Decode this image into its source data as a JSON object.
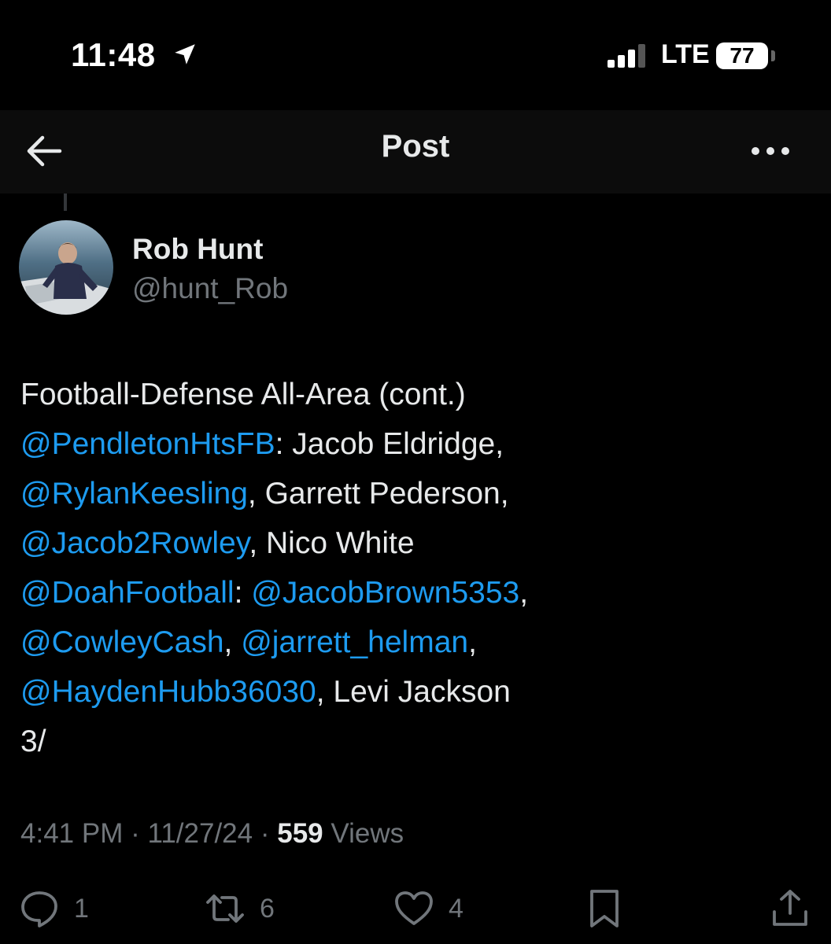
{
  "status_bar": {
    "time": "11:48",
    "network": "LTE",
    "battery": "77",
    "battery_level": 0.77,
    "icons": [
      "location-arrow-icon",
      "signal-bars-icon",
      "battery-icon"
    ]
  },
  "nav": {
    "title": "Post",
    "icons": [
      "back-arrow-icon",
      "more-dots-icon"
    ]
  },
  "post": {
    "author_name": "Rob Hunt",
    "author_handle": "@hunt_Rob",
    "lines": [
      [
        {
          "t": "Football-Defense All-Area (cont.)",
          "m": false
        }
      ],
      [
        {
          "t": "@PendletonHtsFB",
          "m": true
        },
        {
          "t": ": Jacob Eldridge,",
          "m": false
        }
      ],
      [
        {
          "t": "@RylanKeesling",
          "m": true
        },
        {
          "t": ", Garrett Pederson,",
          "m": false
        }
      ],
      [
        {
          "t": "@Jacob2Rowley",
          "m": true
        },
        {
          "t": ", Nico White",
          "m": false
        }
      ],
      [
        {
          "t": "@DoahFootball",
          "m": true
        },
        {
          "t": ": ",
          "m": false
        },
        {
          "t": "@JacobBrown5353",
          "m": true
        },
        {
          "t": ",",
          "m": false
        }
      ],
      [
        {
          "t": "@CowleyCash",
          "m": true
        },
        {
          "t": ", ",
          "m": false
        },
        {
          "t": "@jarrett_helman",
          "m": true
        },
        {
          "t": ",",
          "m": false
        }
      ],
      [
        {
          "t": "@HaydenHubb36030",
          "m": true
        },
        {
          "t": ", Levi Jackson",
          "m": false
        }
      ],
      [
        {
          "t": "3/",
          "m": false
        }
      ]
    ],
    "time": "4:41 PM",
    "date": "11/27/24",
    "views_count": "559",
    "views_label": "Views"
  },
  "actions": {
    "replies": "1",
    "reposts": "6",
    "likes": "4",
    "icons": [
      "reply-icon",
      "repost-icon",
      "like-heart-icon",
      "bookmark-icon",
      "share-icon"
    ]
  },
  "colors": {
    "background": "#000000",
    "text": "#e7e9ea",
    "secondary": "#71767b",
    "mention": "#1d9bf0"
  }
}
